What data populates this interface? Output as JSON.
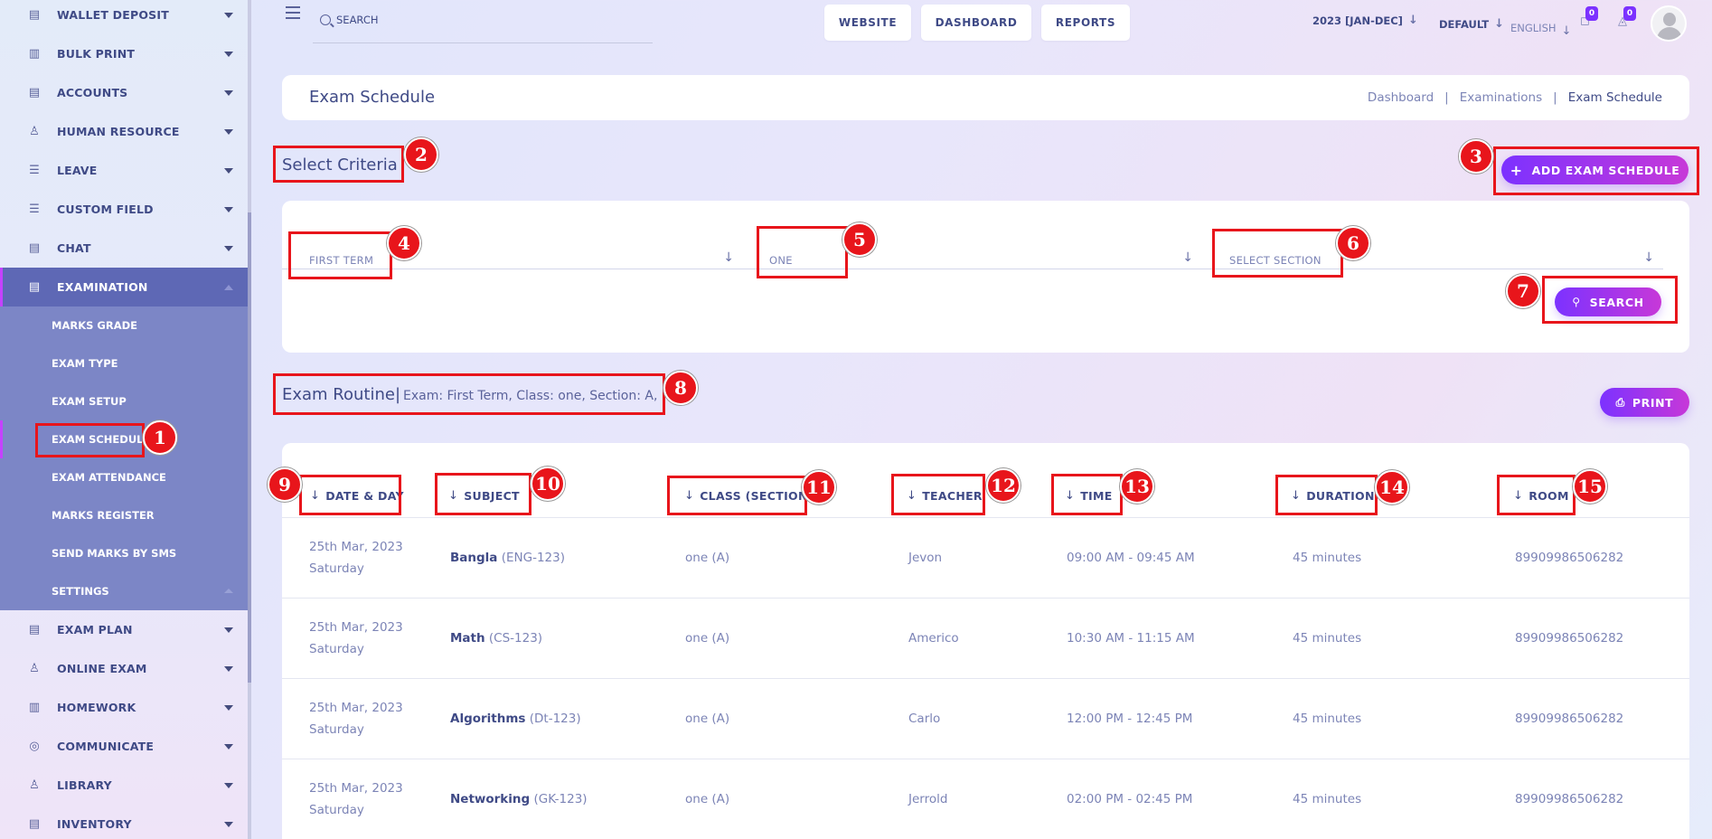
{
  "sidebar": {
    "items": [
      {
        "label": "WALLET DEPOSIT",
        "icon": "wallet-icon"
      },
      {
        "label": "BULK PRINT",
        "icon": "print-icon"
      },
      {
        "label": "ACCOUNTS",
        "icon": "accounts-icon"
      },
      {
        "label": "HUMAN RESOURCE",
        "icon": "person-icon"
      },
      {
        "label": "LEAVE",
        "icon": "leave-icon"
      },
      {
        "label": "CUSTOM FIELD",
        "icon": "custom-field-icon"
      },
      {
        "label": "CHAT",
        "icon": "chat-icon"
      },
      {
        "label": "EXAMINATION",
        "icon": "exam-icon"
      }
    ],
    "submenu": [
      "MARKS GRADE",
      "EXAM TYPE",
      "EXAM SETUP",
      "EXAM SCHEDULE",
      "EXAM ATTENDANCE",
      "MARKS REGISTER",
      "SEND MARKS BY SMS",
      "SETTINGS"
    ],
    "items_after": [
      {
        "label": "EXAM PLAN",
        "icon": "exam-plan-icon"
      },
      {
        "label": "ONLINE EXAM",
        "icon": "online-exam-icon"
      },
      {
        "label": "HOMEWORK",
        "icon": "homework-icon"
      },
      {
        "label": "COMMUNICATE",
        "icon": "communicate-icon"
      },
      {
        "label": "LIBRARY",
        "icon": "library-icon"
      },
      {
        "label": "INVENTORY",
        "icon": "inventory-icon"
      }
    ]
  },
  "topbar": {
    "search_placeholder": "SEARCH",
    "buttons": [
      "WEBSITE",
      "DASHBOARD",
      "REPORTS"
    ],
    "session": "2023 [JAN-DEC]",
    "theme": "DEFAULT",
    "language": "ENGLISH",
    "chat_count": "0",
    "notification_count": "0"
  },
  "page": {
    "title": "Exam Schedule",
    "breadcrumbs": [
      "Dashboard",
      "Examinations",
      "Exam Schedule"
    ]
  },
  "criteria": {
    "title": "Select Criteria",
    "add_button": "ADD EXAM SCHEDULE",
    "exam_value": "FIRST TERM",
    "class_value": "ONE",
    "section_placeholder": "SELECT SECTION",
    "search_button": "SEARCH"
  },
  "routine": {
    "title": "Exam Routine|",
    "subtitle": "Exam: First Term, Class: one, Section: A,",
    "print_button": "PRINT",
    "columns": [
      "DATE & DAY",
      "SUBJECT",
      "CLASS (SECTION)",
      "TEACHER",
      "TIME",
      "DURATION",
      "ROOM"
    ],
    "rows": [
      {
        "date": "25th Mar, 2023",
        "day": "Saturday",
        "subject": "Bangla",
        "code": "(ENG-123)",
        "class": "one (A)",
        "teacher": "Jevon",
        "time": "09:00 AM - 09:45 AM",
        "duration": "45 minutes",
        "room": "89909986506282"
      },
      {
        "date": "25th Mar, 2023",
        "day": "Saturday",
        "subject": "Math",
        "code": "(CS-123)",
        "class": "one (A)",
        "teacher": "Americo",
        "time": "10:30 AM - 11:15 AM",
        "duration": "45 minutes",
        "room": "89909986506282"
      },
      {
        "date": "25th Mar, 2023",
        "day": "Saturday",
        "subject": "Algorithms",
        "code": "(Dt-123)",
        "class": "one (A)",
        "teacher": "Carlo",
        "time": "12:00 PM - 12:45 PM",
        "duration": "45 minutes",
        "room": "89909986506282"
      },
      {
        "date": "25th Mar, 2023",
        "day": "Saturday",
        "subject": "Networking",
        "code": "(GK-123)",
        "class": "one (A)",
        "teacher": "Jerrold",
        "time": "02:00 PM - 02:45 PM",
        "duration": "45 minutes",
        "room": "89909986506282"
      }
    ]
  },
  "annotations": [
    "1",
    "2",
    "3",
    "4",
    "5",
    "6",
    "7",
    "8",
    "9",
    "10",
    "11",
    "12",
    "13",
    "14",
    "15"
  ],
  "colors": {
    "accent": "#7c32ff",
    "accent2": "#c738d8",
    "marker": "#e8151b",
    "sidebar_active": "#5e68b5",
    "submenu": "#7c86c6"
  }
}
